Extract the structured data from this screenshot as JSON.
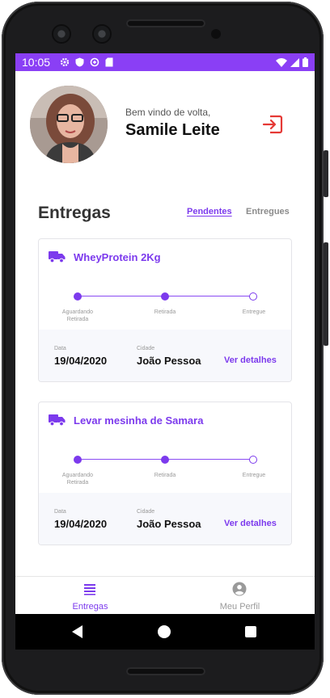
{
  "status_bar": {
    "time": "10:05"
  },
  "header": {
    "welcome": "Bem vindo de volta,",
    "name": "Samile Leite"
  },
  "deliveries": {
    "title": "Entregas",
    "tabs": [
      {
        "label": "Pendentes",
        "active": true
      },
      {
        "label": "Entregues",
        "active": false
      }
    ],
    "cards": [
      {
        "title": "WheyProtein 2Kg",
        "steps": [
          "Aguardando\nRetirada",
          "Retirada",
          "Entregue"
        ],
        "date_label": "Data",
        "date": "19/04/2020",
        "city_label": "Cidade",
        "city": "João Pessoa",
        "details": "Ver detalhes"
      },
      {
        "title": "Levar mesinha de Samara",
        "steps": [
          "Aguardando\nRetirada",
          "Retirada",
          "Entregue"
        ],
        "date_label": "Data",
        "date": "19/04/2020",
        "city_label": "Cidade",
        "city": "João Pessoa",
        "details": "Ver detalhes"
      }
    ]
  },
  "bottom_nav": [
    {
      "label": "Entregas",
      "icon": "list-icon",
      "active": true
    },
    {
      "label": "Meu Perfil",
      "icon": "account-circle-icon",
      "active": false
    }
  ],
  "colors": {
    "accent": "#7c3aed",
    "status_bar": "#8a3ff5",
    "logout_icon": "#e53935"
  }
}
